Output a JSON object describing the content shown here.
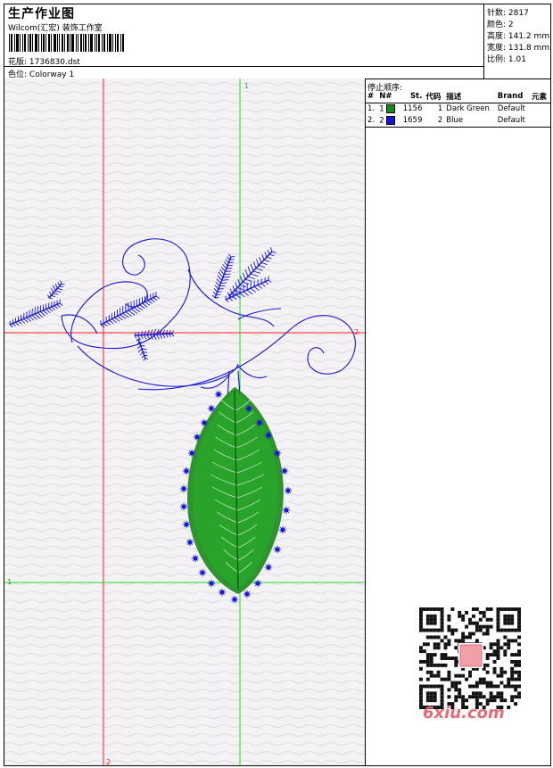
{
  "header": {
    "title": "生产作业图",
    "company": "Wilcom(汇宏) 装饰工作室",
    "design_label": "花版:",
    "design_value": "1736830.dst",
    "colorway_label": "色位:",
    "colorway_value": "Colorway 1"
  },
  "stats": [
    {
      "label": "针数:",
      "value": "2817"
    },
    {
      "label": "颜色:",
      "value": "2"
    },
    {
      "label": "高度:",
      "value": "141.2 mm"
    },
    {
      "label": "宽度:",
      "value": "131.8 mm"
    },
    {
      "label": "比例:",
      "value": "1.01"
    }
  ],
  "stop_sequence": {
    "title": "停止顺序:",
    "columns": [
      "#",
      "N#",
      "St.",
      "代码",
      "描述",
      "Brand",
      "元素"
    ],
    "rows": [
      {
        "index": "1.",
        "n": "1",
        "swatch_color": "#1a8a1a",
        "stitches": "1156",
        "code": "1",
        "description": "Dark Green",
        "brand": "Default",
        "element": ""
      },
      {
        "index": "2.",
        "n": "2",
        "swatch_color": "#1515d8",
        "stitches": "1659",
        "code": "2",
        "description": "Blue",
        "brand": "Default",
        "element": ""
      }
    ]
  },
  "canvas": {
    "markers": {
      "top_green": "1",
      "right_red": "2",
      "left_green": "1",
      "bottom_red": "2"
    },
    "colors": {
      "background": "#f4f2f5",
      "green_thread": "#1a8a1a",
      "blue_thread": "#1515d8",
      "red_guide": "#ff2020",
      "green_guide": "#20dd20"
    }
  },
  "watermark": {
    "site": "6xiu.com",
    "stamp_text": "刺绣图"
  }
}
